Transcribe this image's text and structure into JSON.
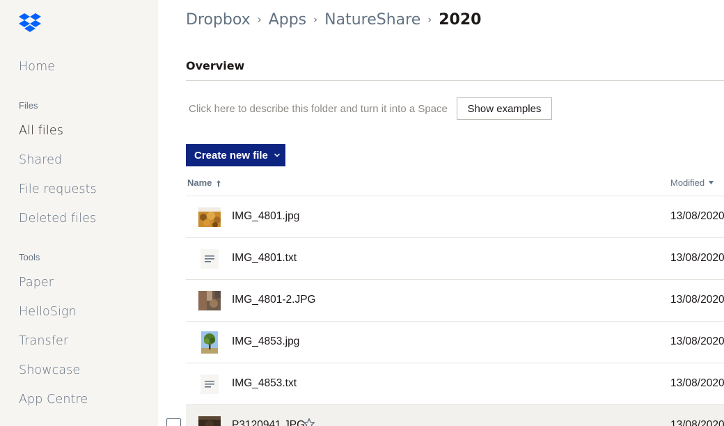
{
  "brand": {
    "logo_icon": "dropbox-logo-icon",
    "color": "#0061fe"
  },
  "sidebar": {
    "items": [
      {
        "label": "Home"
      },
      {
        "label": "All files"
      },
      {
        "label": "Shared"
      },
      {
        "label": "File requests"
      },
      {
        "label": "Deleted files"
      },
      {
        "label": "Paper"
      },
      {
        "label": "HelloSign"
      },
      {
        "label": "Transfer"
      },
      {
        "label": "Showcase"
      },
      {
        "label": "App Centre"
      }
    ],
    "sections": {
      "files": "Files",
      "tools": "Tools"
    },
    "active_item": "All files"
  },
  "breadcrumb": {
    "items": [
      "Dropbox",
      "Apps",
      "NatureShare",
      "2020"
    ],
    "separator": "›"
  },
  "overview": {
    "title": "Overview",
    "describe_placeholder": "Click here to describe this folder and turn it into a Space",
    "show_examples_label": "Show examples"
  },
  "toolbar": {
    "create_label": "Create new file",
    "accent": "#0d2481"
  },
  "table": {
    "columns": {
      "name": "Name",
      "modified": "Modified"
    },
    "sort": {
      "column": "Name",
      "direction": "ascending"
    },
    "rows": [
      {
        "name": "IMG_4801.jpg",
        "modified": "13/08/2020",
        "icon": "image-thumbnail-autumn"
      },
      {
        "name": "IMG_4801.txt",
        "modified": "13/08/2020",
        "icon": "text-file-icon"
      },
      {
        "name": "IMG_4801-2.JPG",
        "modified": "13/08/2020",
        "icon": "image-thumbnail-brown"
      },
      {
        "name": "IMG_4853.jpg",
        "modified": "13/08/2020",
        "icon": "image-thumbnail-tree"
      },
      {
        "name": "IMG_4853.txt",
        "modified": "13/08/2020",
        "icon": "text-file-icon"
      },
      {
        "name": "P3120941.JPG",
        "modified": "13/08/2020",
        "icon": "image-thumbnail-dark"
      }
    ]
  }
}
